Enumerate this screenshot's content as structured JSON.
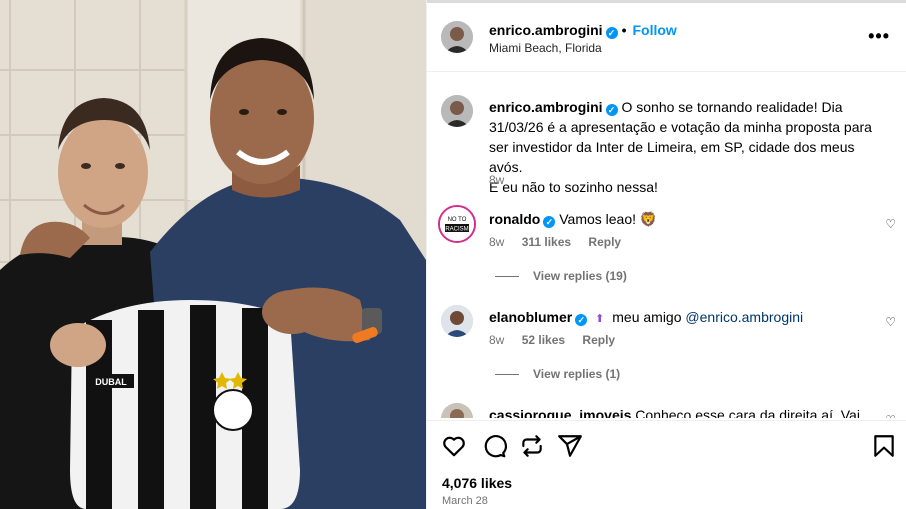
{
  "post": {
    "author": "enrico.ambrogini",
    "follow_label": "Follow",
    "separator": "•",
    "location": "Miami Beach, Florida",
    "more_label": "•••",
    "jersey_brand": "DUBAL",
    "jersey_crest": "A.A. INTERNACIONAL LIMEIRA"
  },
  "caption": {
    "user": "enrico.ambrogini",
    "text": "O sonho se tornando realidade! Dia 31/03/26 é a apresentação e votação da minha proposta para ser investidor da Inter de Limeira, em SP, cidade dos meus avós.",
    "text2": "E eu não to sozinho nessa!",
    "time": "8w"
  },
  "comments": [
    {
      "user": "ronaldo",
      "text": "Vamos leao! 🦁",
      "time": "8w",
      "likes": "311 likes",
      "reply": "Reply",
      "replies": "View replies (19)",
      "avatar_text": "NO TO RACISM"
    },
    {
      "user": "elanoblumer",
      "badge": "⬆",
      "text": "meu amigo",
      "mention": "@enrico.ambrogini",
      "time": "8w",
      "likes": "52 likes",
      "reply": "Reply",
      "replies": "View replies (1)"
    },
    {
      "user": "cassioroque_imoveis",
      "text": "Conheço esse cara da direita aí. Vai"
    }
  ],
  "footer": {
    "likes": "4,076 likes",
    "date": "March 28"
  },
  "icons": {
    "heart": "heart-icon",
    "comment": "comment-icon",
    "repost": "repost-icon",
    "share": "share-icon",
    "save": "bookmark-icon"
  },
  "colors": {
    "accent": "#0095f6",
    "muted": "#737373"
  }
}
